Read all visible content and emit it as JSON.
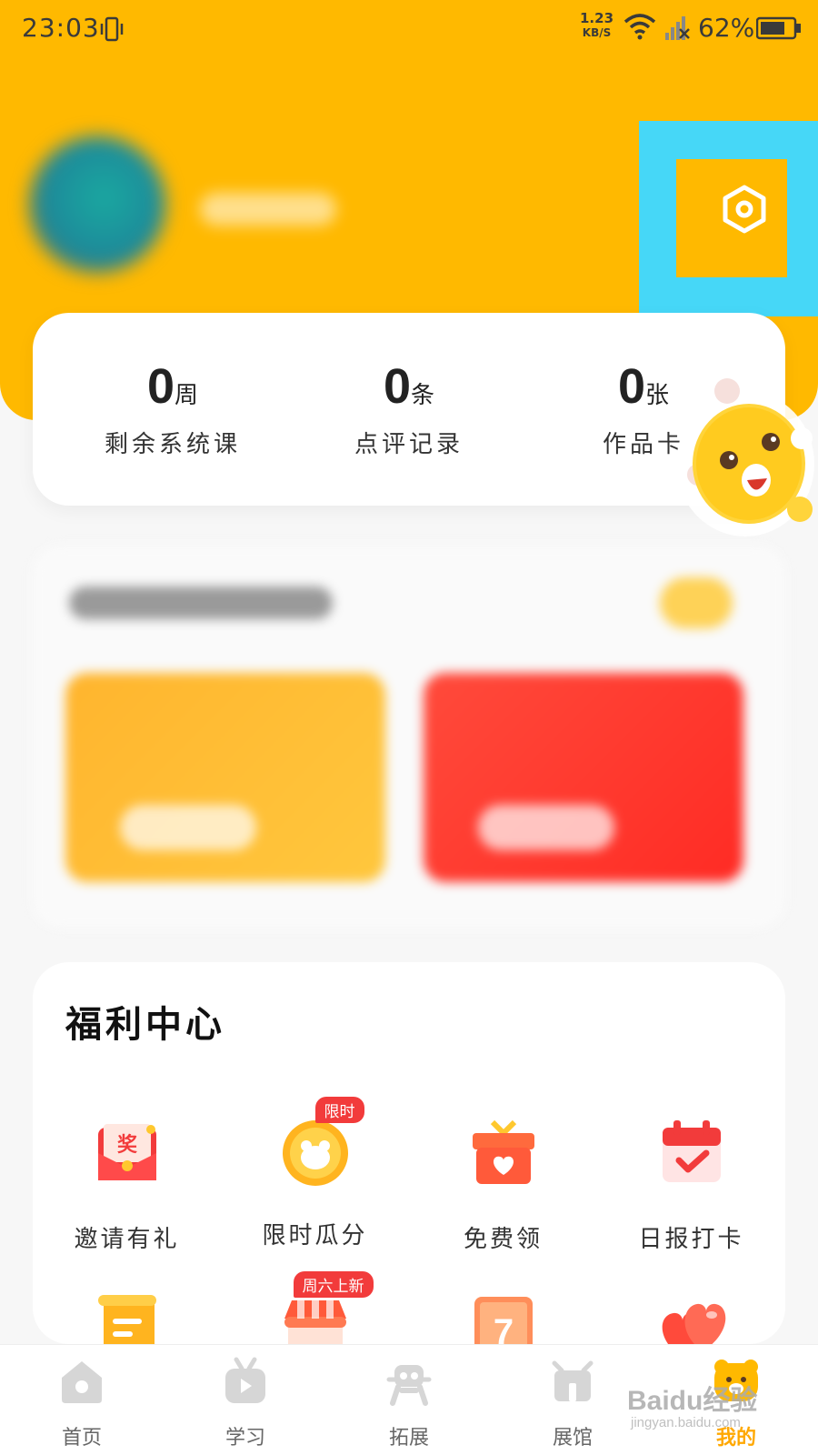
{
  "status_bar": {
    "time": "23:03",
    "net_speed_value": "1.23",
    "net_speed_unit": "KB/S",
    "battery": "62%"
  },
  "stats": [
    {
      "value": "0",
      "unit": "周",
      "label": "剩余系统课"
    },
    {
      "value": "0",
      "unit": "条",
      "label": "点评记录"
    },
    {
      "value": "0",
      "unit": "张",
      "label": "作品卡"
    }
  ],
  "welfare": {
    "title": "福利中心",
    "items": [
      {
        "label": "邀请有礼",
        "icon": "red-envelope-icon"
      },
      {
        "label": "限时瓜分",
        "icon": "gold-coin-icon",
        "badge": "限时"
      },
      {
        "label": "免费领",
        "icon": "gift-box-icon"
      },
      {
        "label": "日报打卡",
        "icon": "calendar-check-icon"
      },
      {
        "label": "",
        "icon": "scroll-icon"
      },
      {
        "label": "",
        "icon": "shop-icon",
        "badge": "周六上新"
      },
      {
        "label": "",
        "icon": "seven-day-calendar-icon"
      },
      {
        "label": "",
        "icon": "hearts-icon"
      }
    ]
  },
  "nav": [
    {
      "label": "首页",
      "icon": "home-icon"
    },
    {
      "label": "学习",
      "icon": "tv-play-icon"
    },
    {
      "label": "拓展",
      "icon": "robot-icon"
    },
    {
      "label": "展馆",
      "icon": "gallery-icon"
    },
    {
      "label": "我的",
      "icon": "bear-face-icon",
      "active": true
    }
  ],
  "watermark": {
    "main": "Baidu经验",
    "sub": "jingyan.baidu.com"
  },
  "colors": {
    "accent": "#FFB900",
    "highlight": "#46D7F7",
    "badge": "#F23B3B"
  }
}
